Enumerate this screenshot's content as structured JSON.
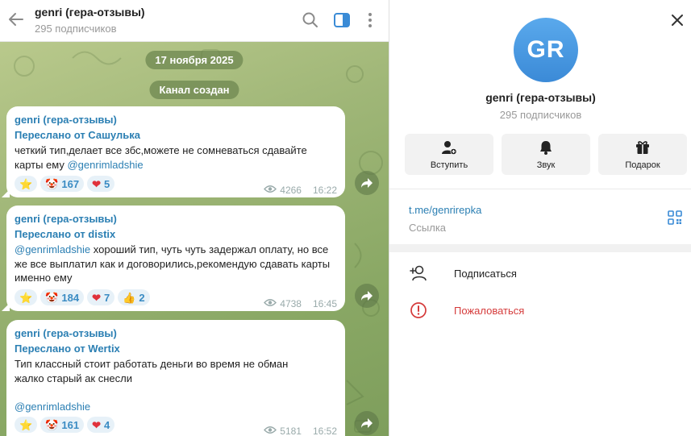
{
  "header": {
    "title": "genri (гера-отзывы)",
    "subtitle": "295 подписчиков"
  },
  "chat": {
    "date_pill": "17 ноября 2025",
    "service_pill": "Канал создан",
    "messages": [
      {
        "author": "genri (гера-отзывы)",
        "forwarded": "Переслано от Сашулька",
        "text_parts": [
          "четкий тип,делает все збс,можете не сомневаться сдавайте карты ему ",
          "@genrimladshie"
        ],
        "reactions": [
          {
            "emoji": "⭐",
            "count": ""
          },
          {
            "emoji": "🤡",
            "count": "167"
          },
          {
            "emoji": "❤",
            "count": "5"
          }
        ],
        "views": "4266",
        "time": "16:22"
      },
      {
        "author": "genri (гера-отзывы)",
        "forwarded": "Переслано от distix",
        "text_parts": [
          "@genrimladshie",
          " хороший тип, чуть чуть задержал оплату, но все же все выплатил как и договорились,рекомендую сдавать карты именно ему"
        ],
        "reactions": [
          {
            "emoji": "⭐",
            "count": ""
          },
          {
            "emoji": "🤡",
            "count": "184"
          },
          {
            "emoji": "❤",
            "count": "7"
          },
          {
            "emoji": "👍",
            "count": "2"
          }
        ],
        "views": "4738",
        "time": "16:45"
      },
      {
        "author": "genri (гера-отзывы)",
        "forwarded": "Переслано от Wertix",
        "text_lines": [
          "Тип классный стоит работать деньги во время не обман",
          "жалко старый ак снесли"
        ],
        "mention": "@genrimladshie",
        "reactions": [
          {
            "emoji": "⭐",
            "count": ""
          },
          {
            "emoji": "🤡",
            "count": "161"
          },
          {
            "emoji": "❤",
            "count": "4"
          }
        ],
        "views": "5181",
        "time": "16:52"
      }
    ]
  },
  "panel": {
    "avatar_initials": "GR",
    "name": "genri (гера-отзывы)",
    "subscribers": "295 подписчиков",
    "actions": [
      {
        "label": "Вступить",
        "icon": "join-icon"
      },
      {
        "label": "Звук",
        "icon": "bell-icon"
      },
      {
        "label": "Подарок",
        "icon": "gift-icon"
      }
    ],
    "link": {
      "url": "t.me/genrirepka",
      "label": "Ссылка"
    },
    "menu": [
      {
        "label": "Подписаться",
        "icon": "add-user-icon"
      },
      {
        "label": "Пожаловаться",
        "icon": "report-icon"
      }
    ]
  },
  "colors": {
    "accent": "#2b7fb3",
    "avatar": "#4a9be4",
    "danger": "#d53b3b",
    "chat_bg": "#9fb677"
  }
}
